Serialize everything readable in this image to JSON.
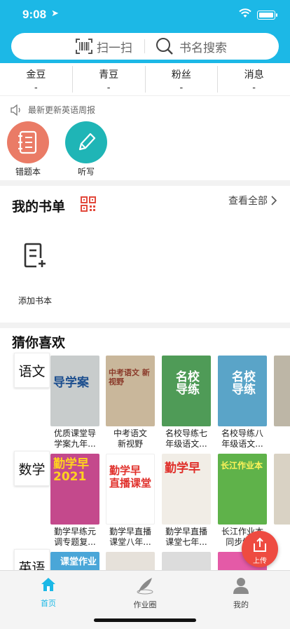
{
  "status_bar": {
    "time": "9:08"
  },
  "search": {
    "scan_label": "扫一扫",
    "search_label": "书名搜索"
  },
  "stats": [
    {
      "label": "金豆",
      "value": "-"
    },
    {
      "label": "青豆",
      "value": "-"
    },
    {
      "label": "粉丝",
      "value": "-"
    },
    {
      "label": "消息",
      "value": "-"
    }
  ],
  "notice": {
    "text": "最新更新英语周报"
  },
  "quick_actions": [
    {
      "label": "错题本",
      "icon": "notebook-icon",
      "color": "#ea7b66"
    },
    {
      "label": "听写",
      "icon": "pen-icon",
      "color": "#1fb5b6"
    }
  ],
  "my_books": {
    "title": "我的书单",
    "view_all": "查看全部",
    "add_label": "添加书本"
  },
  "recommend": {
    "title": "猜你喜欢",
    "rows": [
      {
        "subject": "语文",
        "books": [
          {
            "title": "优质课堂导\n学案九年...",
            "cover_text": "导学案",
            "cover_color": "#c8cccc"
          },
          {
            "title": "中考语文\n新视野",
            "cover_text": "中考语文\n新视野",
            "cover_color": "#c9b79b"
          },
          {
            "title": "名校导练七\n年级语文...",
            "cover_text": "名校\n导练",
            "cover_color": "#4f9b57"
          },
          {
            "title": "名校导练八\n年级语文...",
            "cover_text": "名校\n导练",
            "cover_color": "#5aa4c8"
          }
        ]
      },
      {
        "subject": "数学",
        "books": [
          {
            "title": "勤学早练元\n调专题复...",
            "cover_text": "勤学早\n2021",
            "cover_color": "#c4498c"
          },
          {
            "title": "勤学早直播\n课堂八年...",
            "cover_text": "勤学早\n直播课堂",
            "cover_color": "#ffffff"
          },
          {
            "title": "勤学早直播\n课堂七年...",
            "cover_text": "勤学早",
            "cover_color": "#f1ede6"
          },
          {
            "title": "长江作业本\n同步练...",
            "cover_text": "长江作业本",
            "cover_color": "#5fb24a"
          }
        ]
      },
      {
        "subject": "英语",
        "books": [
          {
            "title": "",
            "cover_text": "课堂作业",
            "cover_color": "#4aa6d8"
          },
          {
            "title": "",
            "cover_text": "",
            "cover_color": "#e6e1da"
          },
          {
            "title": "",
            "cover_text": "",
            "cover_color": "#dcdcdc"
          },
          {
            "title": "",
            "cover_text": "",
            "cover_color": "#e45aa7"
          }
        ]
      }
    ]
  },
  "fab": {
    "label": "上传"
  },
  "tabbar": [
    {
      "label": "首页",
      "icon": "home-icon",
      "active": true
    },
    {
      "label": "作业圈",
      "icon": "feather-icon",
      "active": false
    },
    {
      "label": "我的",
      "icon": "profile-icon",
      "active": false
    }
  ],
  "colors": {
    "accent": "#1cb8e6",
    "fab": "#ee4b41",
    "active_tab": "#1cb8e6"
  }
}
